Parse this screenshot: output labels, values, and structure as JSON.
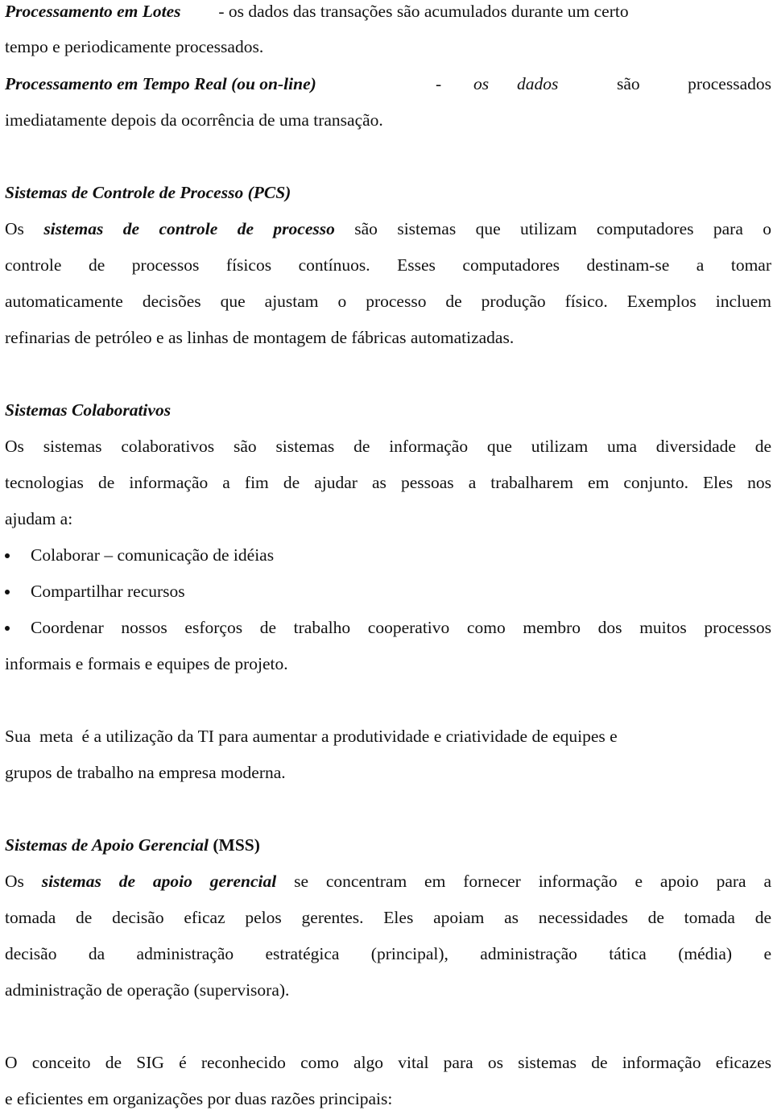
{
  "document": {
    "intro": {
      "batch": {
        "term": "Processamento em Lotes",
        "definition_line1": "- os dados das transações são acumulados durante um certo",
        "definition_line2": "tempo e periodicamente processados."
      },
      "realtime": {
        "term": "Processamento em Tempo Real (ou on-line)",
        "dash": "-",
        "w1": "os",
        "w2": "dados",
        "w3": "são",
        "w4": "processados",
        "definition_line2": "imediatamente depois da ocorrência de uma transação."
      }
    },
    "pcs": {
      "heading": "Sistemas de Controle de Processo (PCS)",
      "lines": [
        {
          "prefix": "Os",
          "emph": "sistemas de controle de processo",
          "rest": "são sistemas que utilizam computadores para o"
        },
        "controle de processos físicos contínuos. Esses computadores destinam-se a tomar",
        "automaticamente decisões que ajustam o processo de produção físico. Exemplos incluem",
        "refinarias de petróleo e as linhas de montagem de fábricas automatizadas."
      ]
    },
    "collab": {
      "heading": "Sistemas Colaborativos",
      "lines": [
        "Os sistemas colaborativos são sistemas de informação que utilizam uma diversidade de",
        "tecnologias de informação a fim de ajudar as pessoas a trabalharem em conjunto. Eles nos",
        "ajudam a:"
      ],
      "bullets": [
        "Colaborar – comunicação de idéias",
        "Compartilhar recursos",
        "Coordenar nossos esforços de trabalho cooperativo como membro dos muitos processos"
      ],
      "bullet_continuation": "informais e formais e equipes de projeto."
    },
    "goal": {
      "lines": [
        "Sua  meta  é a utilização da TI para aumentar a produtividade e criatividade de equipes e",
        "grupos de trabalho na empresa moderna."
      ]
    },
    "mss": {
      "heading_italic": "Sistemas de Apoio Gerencial",
      "heading_abbr": "(MSS)",
      "lines": [
        {
          "prefix": "Os",
          "emph": "sistemas de apoio gerencial",
          "rest": "se concentram em fornecer informação e apoio para a"
        },
        "tomada de decisão eficaz pelos gerentes. Eles apoiam as necessidades de tomada de",
        "decisão da administração estratégica (principal), administração tática (média) e",
        "administração de operação (supervisora)."
      ]
    },
    "sig": {
      "lines": [
        "O conceito de SIG é reconhecido como algo vital para os sistemas de informação eficazes",
        "e eficientes em organizações por duas razões principais:"
      ]
    }
  }
}
